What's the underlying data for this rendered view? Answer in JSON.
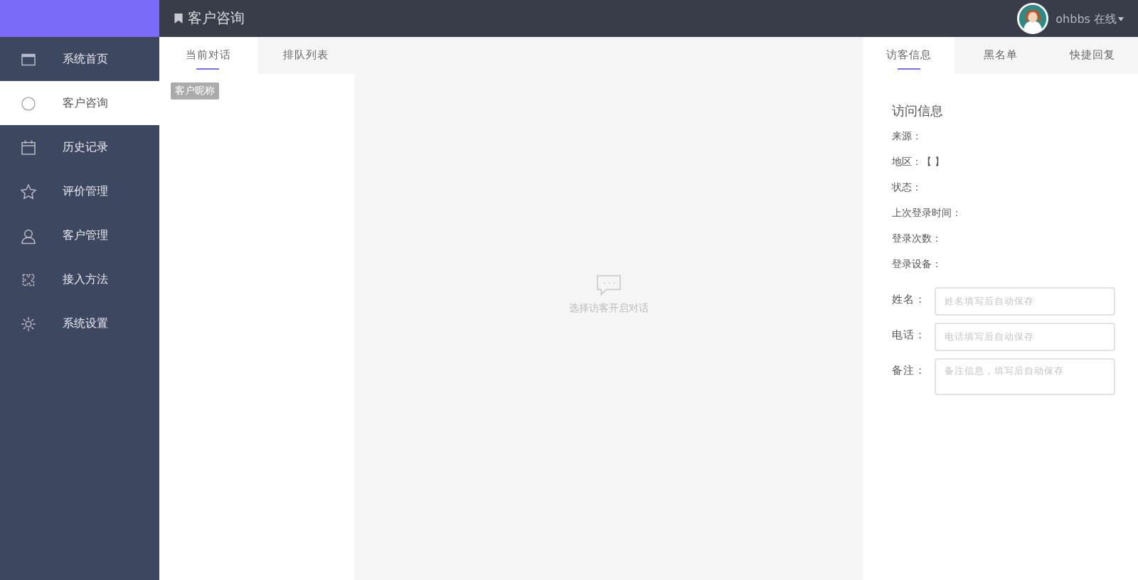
{
  "header": {
    "title": "客户咨询",
    "user": "ohbbs 在线"
  },
  "sidebar": {
    "items": [
      {
        "label": "系统首页",
        "selected": false
      },
      {
        "label": "客户咨询",
        "selected": true
      },
      {
        "label": "历史记录",
        "selected": false
      },
      {
        "label": "评价管理",
        "selected": false
      },
      {
        "label": "客户管理",
        "selected": false
      },
      {
        "label": "接入方法",
        "selected": false
      },
      {
        "label": "系统设置",
        "selected": false
      }
    ]
  },
  "conversation_tabs": [
    {
      "label": "当前对话",
      "selected": true
    },
    {
      "label": "排队列表",
      "selected": false
    }
  ],
  "tooltip": "客户昵称",
  "empty_state": "选择访客开启对话",
  "info_tabs": [
    {
      "label": "访客信息",
      "selected": true
    },
    {
      "label": "黑名单",
      "selected": false
    },
    {
      "label": "快捷回复",
      "selected": false
    }
  ],
  "info": {
    "heading": "访问信息",
    "lines": [
      "来源：",
      "地区：【 】",
      "状态：",
      "上次登录时间：",
      "登录次数：",
      "登录设备："
    ]
  },
  "fields": [
    {
      "label": "姓名：",
      "placeholder": "姓名填写后自动保存",
      "kind": "input"
    },
    {
      "label": "电话：",
      "placeholder": "电话填写后自动保存",
      "kind": "input"
    },
    {
      "label": "备注：",
      "placeholder": "备注信息，填写后自动保存",
      "kind": "textarea"
    }
  ]
}
